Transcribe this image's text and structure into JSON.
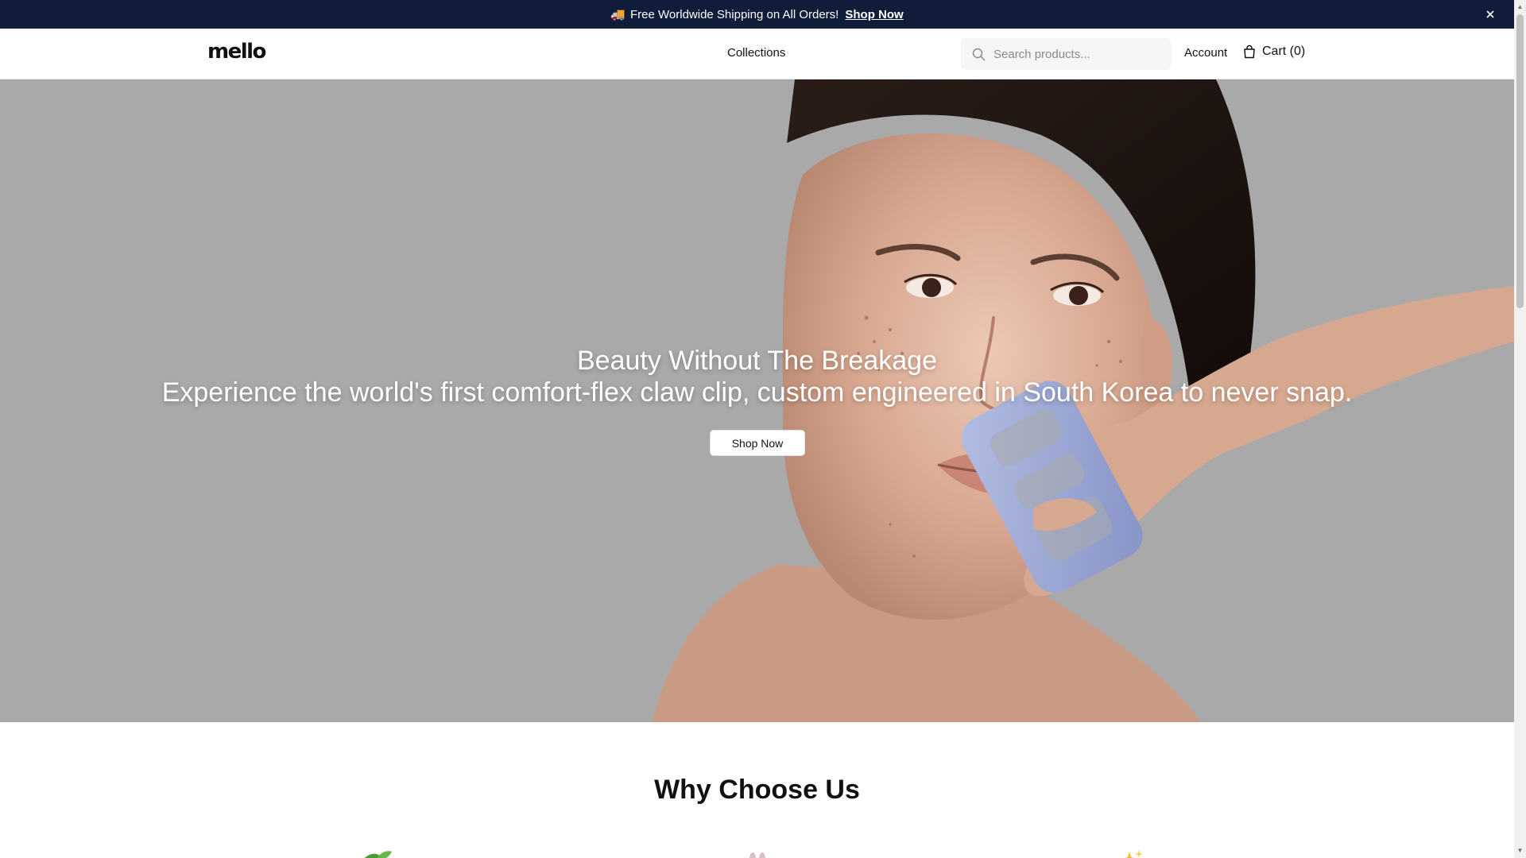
{
  "announcement": {
    "icon": "truck-icon",
    "text": "Free Worldwide Shipping on All Orders!",
    "link": "Shop Now",
    "close_icon": "close-icon"
  },
  "header": {
    "logo": "mello",
    "nav": {
      "collections": "Collections"
    },
    "search": {
      "placeholder": "Search products...",
      "value": ""
    },
    "account": "Account",
    "cart": "Cart (0)"
  },
  "hero": {
    "title": "Beauty Without The Breakage",
    "subtitle": "Experience the world's first comfort-flex claw clip, custom engineered in South Korea to never snap.",
    "button": "Shop Now"
  },
  "why": {
    "title": "Why Choose Us",
    "features": [
      {
        "icon": "leaf-icon"
      },
      {
        "icon": "bunny-icon"
      },
      {
        "icon": "sparkles-icon"
      }
    ]
  },
  "colors": {
    "announcement_bg": "#0f1d3a",
    "hero_bg": "#a9a9a9",
    "clip": "#9ea9d6"
  }
}
